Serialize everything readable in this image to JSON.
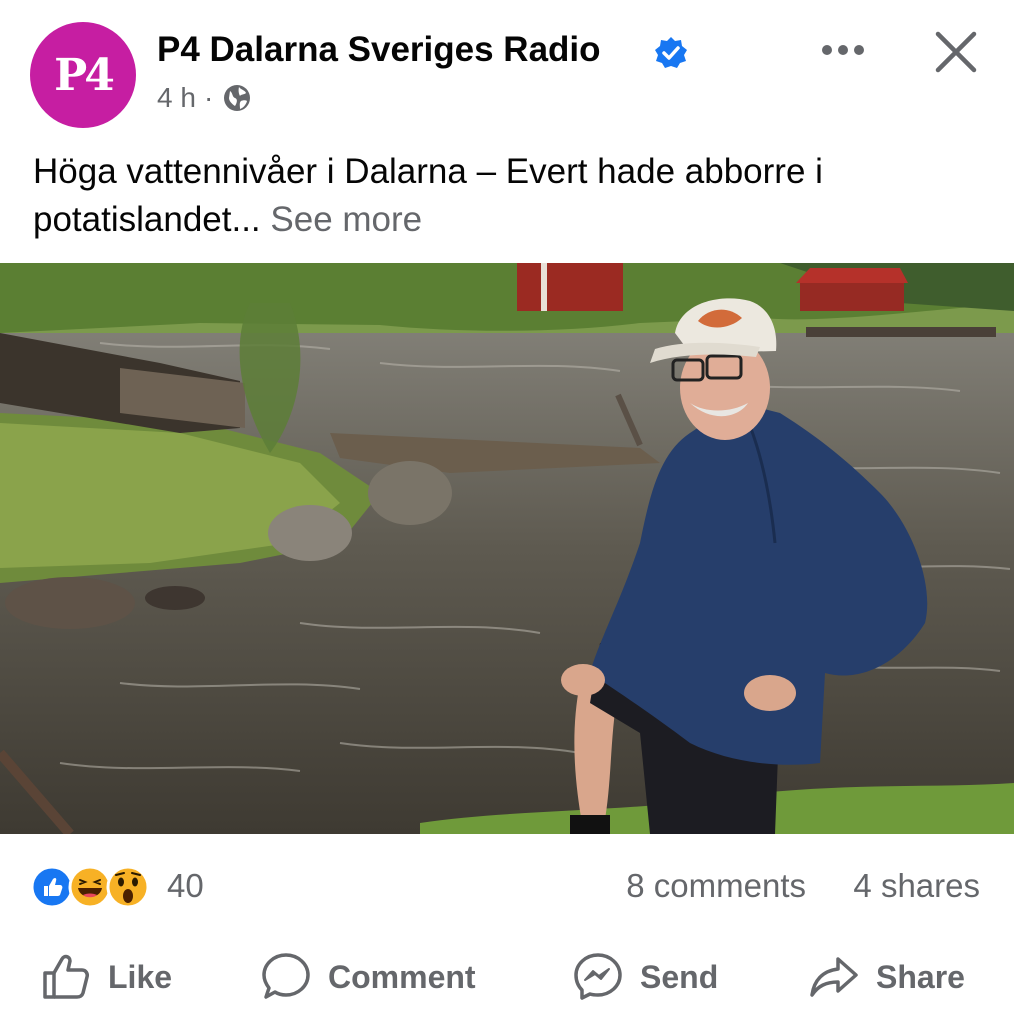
{
  "post": {
    "avatar_text": "P4",
    "page_name": "P4 Dalarna Sveriges Radio",
    "time": "4 h",
    "dot": "·",
    "text": "Höga vattennivåer i Dalarna – Evert hade abborre i potatislandet...",
    "see_more": "See more"
  },
  "engagement": {
    "reaction_count": "40",
    "comments": "8 comments",
    "shares": "4 shares",
    "reaction_icons": [
      "like-icon",
      "haha-icon",
      "wow-icon"
    ]
  },
  "actions": {
    "like": "Like",
    "comment": "Comment",
    "send": "Send",
    "share": "Share"
  },
  "colors": {
    "brand": "#c61ea2",
    "facebook_blue": "#1877f2",
    "secondary_text": "#65676b"
  }
}
